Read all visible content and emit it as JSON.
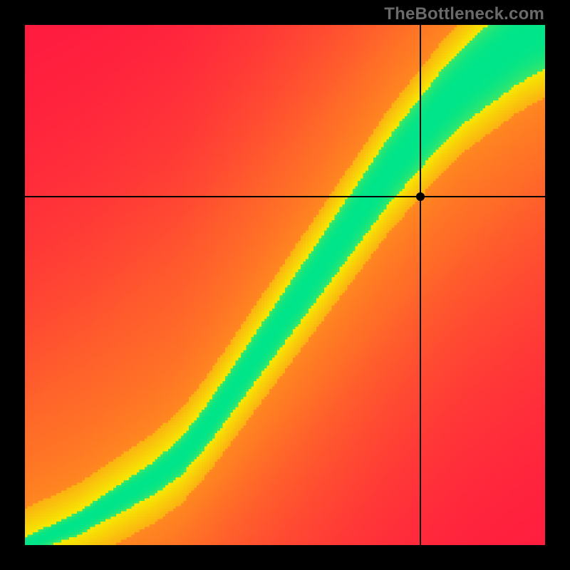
{
  "attribution": "TheBottleneck.com",
  "chart_data": {
    "type": "heatmap",
    "title": "",
    "xlabel": "",
    "ylabel": "",
    "xlim": [
      0,
      1
    ],
    "ylim": [
      0,
      1
    ],
    "description": "Red→yellow→green heatmap showing a narrow green diagonal band (optimal region) running from lower-left to upper-right, widening toward the top-right. Red dominates far-off-diagonal regions. Two black crosshair lines mark a selected point.",
    "selected_point": {
      "x": 0.76,
      "y": 0.67
    },
    "band": {
      "center_curve": [
        [
          0.0,
          0.0
        ],
        [
          0.05,
          0.02
        ],
        [
          0.1,
          0.04
        ],
        [
          0.15,
          0.07
        ],
        [
          0.2,
          0.1
        ],
        [
          0.25,
          0.13
        ],
        [
          0.3,
          0.17
        ],
        [
          0.35,
          0.23
        ],
        [
          0.4,
          0.3
        ],
        [
          0.45,
          0.37
        ],
        [
          0.5,
          0.44
        ],
        [
          0.55,
          0.51
        ],
        [
          0.6,
          0.58
        ],
        [
          0.65,
          0.65
        ],
        [
          0.7,
          0.72
        ],
        [
          0.75,
          0.78
        ],
        [
          0.8,
          0.84
        ],
        [
          0.85,
          0.89
        ],
        [
          0.9,
          0.93
        ],
        [
          0.95,
          0.97
        ],
        [
          1.0,
          1.0
        ]
      ],
      "half_width_start": 0.015,
      "half_width_end": 0.085,
      "yellow_extra": 0.055
    },
    "palette": {
      "red": "#ff1c3f",
      "orange": "#ff8a1f",
      "yellow": "#f6e900",
      "green": "#00e589"
    }
  }
}
